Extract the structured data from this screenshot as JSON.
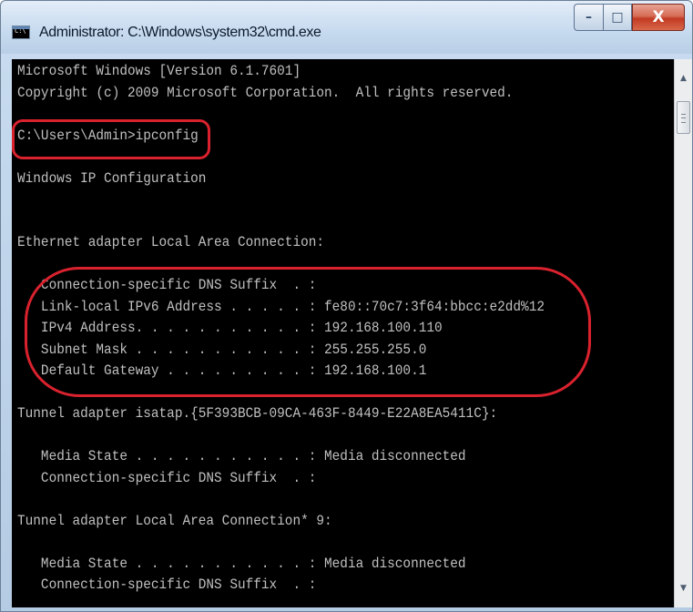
{
  "window": {
    "title": "Administrator: C:\\Windows\\system32\\cmd.exe",
    "app_icon": "command-prompt-icon",
    "caption_buttons": {
      "minimize_glyph": "–",
      "maximize_glyph": "□",
      "close_glyph": "X"
    },
    "colors": {
      "console_background": "#000000",
      "console_text": "#c0c0c0",
      "highlight_outline": "#d9222e"
    }
  },
  "console": {
    "lines": [
      "Microsoft Windows [Version 6.1.7601]",
      "Copyright (c) 2009 Microsoft Corporation.  All rights reserved.",
      "",
      "C:\\Users\\Admin>ipconfig",
      "",
      "Windows IP Configuration",
      "",
      "",
      "Ethernet adapter Local Area Connection:",
      "",
      "   Connection-specific DNS Suffix  . :",
      "   Link-local IPv6 Address . . . . . : fe80::70c7:3f64:bbcc:e2dd%12",
      "   IPv4 Address. . . . . . . . . . . : 192.168.100.110",
      "   Subnet Mask . . . . . . . . . . . : 255.255.255.0",
      "   Default Gateway . . . . . . . . . : 192.168.100.1",
      "",
      "Tunnel adapter isatap.{5F393BCB-09CA-463F-8449-E22A8EA5411C}:",
      "",
      "   Media State . . . . . . . . . . . : Media disconnected",
      "   Connection-specific DNS Suffix  . :",
      "",
      "Tunnel adapter Local Area Connection* 9:",
      "",
      "   Media State . . . . . . . . . . . : Media disconnected",
      "   Connection-specific DNS Suffix  . :"
    ]
  },
  "scrollbar": {
    "up_arrow": "▲",
    "down_arrow": "▼",
    "up_icon": "scroll-up-arrow-icon",
    "down_icon": "scroll-down-arrow-icon"
  }
}
